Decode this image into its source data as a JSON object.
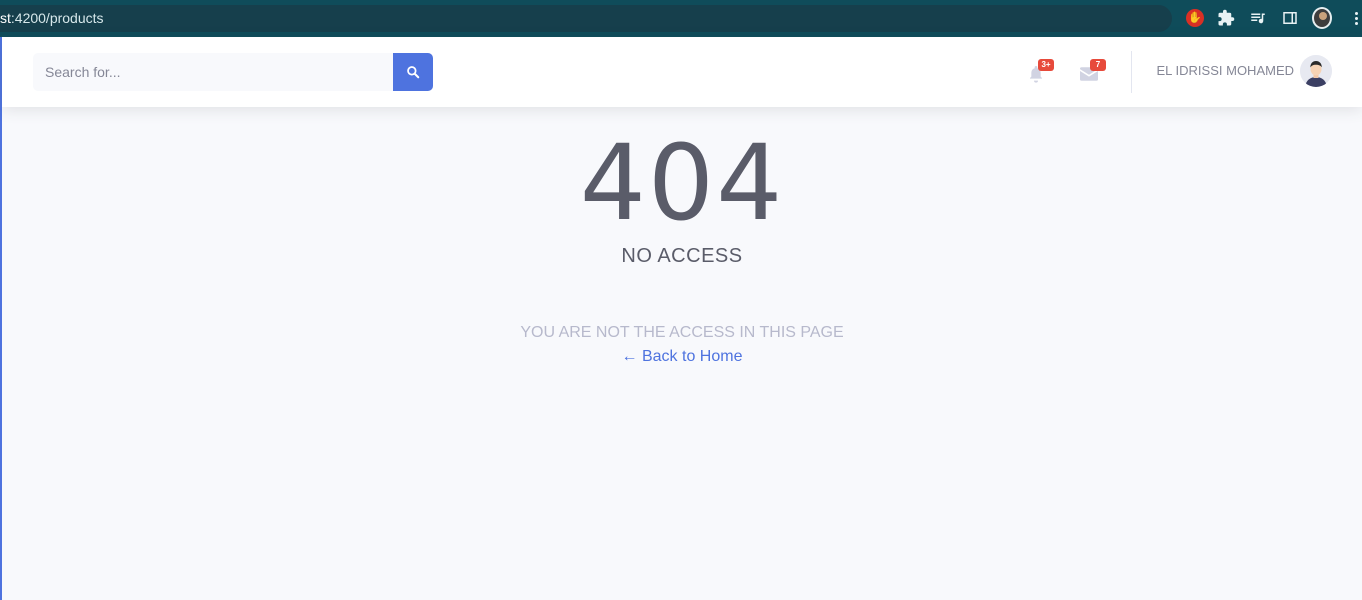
{
  "browser": {
    "url_host": "st",
    "url_path": ":4200/products"
  },
  "topbar": {
    "search_placeholder": "Search for...",
    "alerts_badge": "3+",
    "messages_badge": "7",
    "user_name": "EL IDRISSI MOHAMED"
  },
  "error": {
    "code": "404",
    "title": "NO ACCESS",
    "message": "YOU ARE NOT THE ACCESS IN THIS PAGE",
    "back_link": "← Back to Home"
  },
  "colors": {
    "primary": "#4e73df",
    "danger": "#e74a3b",
    "text_dark": "#5a5c69",
    "text_muted": "#b7b9cc",
    "chrome": "#0f4c5a"
  },
  "icons": [
    "block-extension-icon",
    "puzzle-icon",
    "media-icon",
    "side-panel-icon",
    "profile-icon",
    "kebab-menu-icon",
    "search-icon",
    "bell-icon",
    "envelope-icon",
    "user-avatar"
  ]
}
